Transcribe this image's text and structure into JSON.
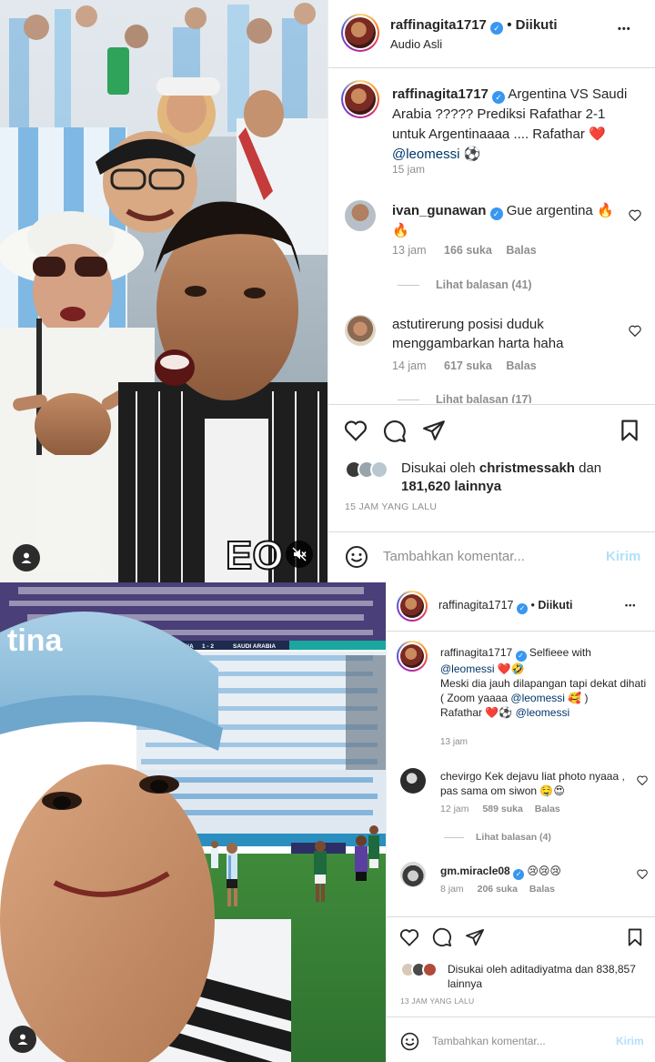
{
  "post1": {
    "header": {
      "username": "raffinagita1717",
      "dot": "•",
      "follow_status": "Diikuti",
      "subtitle": "Audio Asli",
      "more": "•••"
    },
    "caption": {
      "username": "raffinagita1717",
      "text_a": "Argentina VS Saudi Arabia ????? Prediksi Rafathar 2-1 untuk Argentinaaaa .... Rafathar",
      "emoji_a": "❤️",
      "mention": "@leomessi",
      "emoji_b": "⚽",
      "time": "15 jam"
    },
    "comments": [
      {
        "username": "ivan_gunawan",
        "text": "Gue argentina",
        "emoji": "🔥",
        "emoji2": "🔥",
        "time": "13 jam",
        "likes": "166 suka",
        "reply": "Balas",
        "replies": "Lihat balasan (41)"
      },
      {
        "username": "astutirerung",
        "text": "posisi duduk menggambarkan harta haha",
        "time": "14 jam",
        "likes": "617 suka",
        "reply": "Balas",
        "replies": "Lihat balasan (17)"
      }
    ],
    "likes": {
      "prefix": "Disukai oleh",
      "user": "christmessakh",
      "conj": "dan",
      "count": "181,620 lainnya"
    },
    "timestamp": "15 JAM YANG LALU",
    "comment_box": {
      "placeholder": "Tambahkan komentar...",
      "submit": "Kirim"
    }
  },
  "post2": {
    "header": {
      "username": "raffinagita1717",
      "dot": "•",
      "follow_status": "Diikuti",
      "more": "•••"
    },
    "caption": {
      "username": "raffinagita1717",
      "line1": "Selfieee with",
      "mention1": "@leomessi",
      "emoji1": "❤️🤣",
      "line2": "Meski dia jauh dilapangan tapi dekat dihati",
      "line3a": "( Zoom yaaaa",
      "mention2": "@leomessi",
      "emoji2": "🥰 )",
      "line4a": "Rafathar",
      "emoji3": "❤️⚽",
      "mention3": "@leomessi",
      "time": "13 jam"
    },
    "scoreboard": {
      "team_a": "ARGENTINA",
      "score": "1 - 2",
      "team_b": "SAUDI ARABIA",
      "cap_text": "tina"
    },
    "comments": [
      {
        "username": "chevirgo",
        "text": "Kek dejavu liat photo nyaaa , pas sama om siwon",
        "emoji": "🤤😍",
        "time": "12 jam",
        "likes": "589 suka",
        "reply": "Balas",
        "replies": "Lihat balasan (4)"
      },
      {
        "username": "gm.miracle08",
        "emoji": "😢😢😢",
        "time": "8 jam",
        "likes": "206 suka",
        "reply": "Balas"
      }
    ],
    "likes": {
      "prefix": "Disukai oleh",
      "user": "aditadiyatma",
      "conj": "dan",
      "count": "838,857 lainnya"
    },
    "timestamp": "13 JAM YANG LALU",
    "comment_box": {
      "placeholder": "Tambahkan komentar...",
      "submit": "Kirim"
    }
  },
  "icons": {
    "heart": "heart-icon",
    "comment": "comment-icon",
    "share": "share-icon",
    "bookmark": "bookmark-icon",
    "emoji": "emoji-icon",
    "mute": "mute-icon",
    "user": "user-icon"
  },
  "colors": {
    "link": "#00376b",
    "muted": "#8e8e8e",
    "verified": "#3897f0",
    "submit": "#b2dffc"
  }
}
